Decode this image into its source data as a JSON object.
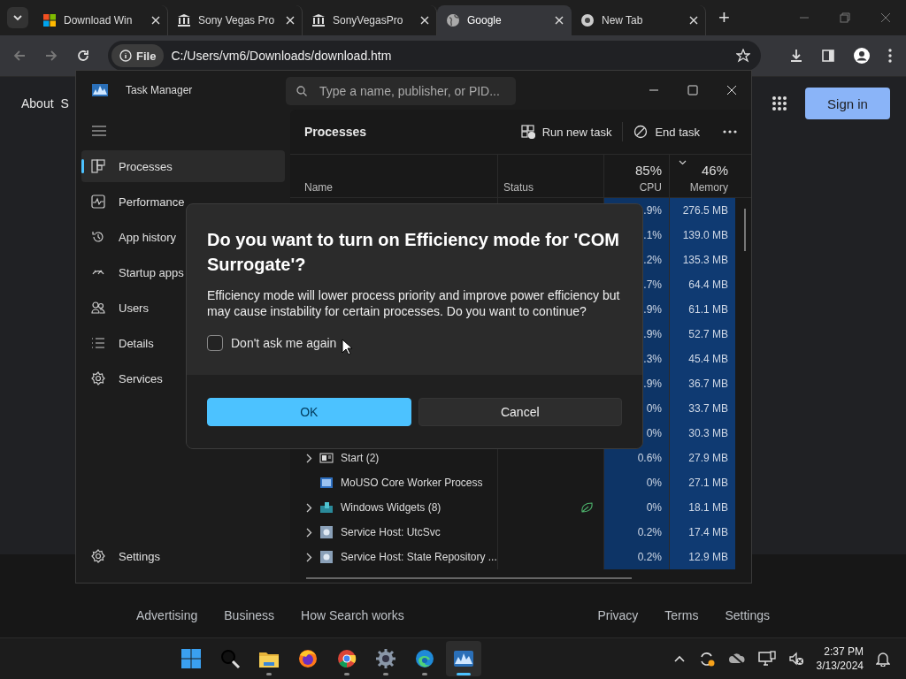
{
  "browser": {
    "tabs": [
      {
        "title": "Download Win",
        "selected": false
      },
      {
        "title": "Sony Vegas Pro",
        "selected": false
      },
      {
        "title": "SonyVegasPro",
        "selected": false
      },
      {
        "title": "Google",
        "selected": true
      },
      {
        "title": "New Tab",
        "selected": false
      }
    ],
    "new_tab": "+",
    "address": {
      "scheme": "File",
      "url": "C:/Users/vm6/Downloads/download.htm"
    }
  },
  "page": {
    "header_links": [
      "About",
      "S"
    ],
    "sign_in": "Sign in",
    "footer_left": [
      "Advertising",
      "Business",
      "How Search works"
    ],
    "footer_right": [
      "Privacy",
      "Terms",
      "Settings"
    ]
  },
  "task_manager": {
    "title": "Task Manager",
    "search": {
      "placeholder": "Type a name, publisher, or PID..."
    },
    "nav": [
      {
        "label": "Processes",
        "selected": true
      },
      {
        "label": "Performance",
        "selected": false
      },
      {
        "label": "App history",
        "selected": false
      },
      {
        "label": "Startup apps",
        "selected": false
      },
      {
        "label": "Users",
        "selected": false
      },
      {
        "label": "Details",
        "selected": false
      },
      {
        "label": "Services",
        "selected": false
      }
    ],
    "settings": "Settings",
    "heading": "Processes",
    "actions": [
      "Run new task",
      "End task"
    ],
    "columns": {
      "name": "Name",
      "status": "Status",
      "cpu_total": "85%",
      "cpu": "CPU",
      "memory_total": "46%",
      "memory": "Memory"
    },
    "rows": [
      {
        "cpu": ".9%",
        "memory": "276.5 MB"
      },
      {
        "cpu": ".1%",
        "memory": "139.0 MB"
      },
      {
        "cpu": ".2%",
        "memory": "135.3 MB"
      },
      {
        "cpu": ".7%",
        "memory": "64.4 MB"
      },
      {
        "cpu": ".9%",
        "memory": "61.1 MB"
      },
      {
        "cpu": ".9%",
        "memory": "52.7 MB"
      },
      {
        "cpu": ".3%",
        "memory": "45.4 MB"
      },
      {
        "cpu": ".9%",
        "memory": "36.7 MB"
      },
      {
        "cpu": "0%",
        "memory": "33.7 MB"
      },
      {
        "cpu": "0%",
        "memory": "30.3 MB"
      },
      {
        "name": "Start (2)",
        "kind": "start",
        "expandable": true,
        "efficiency": false,
        "cpu": "0.6%",
        "memory": "27.9 MB"
      },
      {
        "name": "MoUSO Core Worker Process",
        "kind": "app",
        "expandable": false,
        "efficiency": false,
        "cpu": "0%",
        "memory": "27.1 MB"
      },
      {
        "name": "Windows Widgets (8)",
        "kind": "widgets",
        "expandable": true,
        "efficiency": true,
        "cpu": "0%",
        "memory": "18.1 MB"
      },
      {
        "name": "Service Host: UtcSvc",
        "kind": "service",
        "expandable": true,
        "efficiency": false,
        "cpu": "0.2%",
        "memory": "17.4 MB"
      },
      {
        "name": "Service Host: State Repository ...",
        "kind": "service",
        "expandable": true,
        "efficiency": false,
        "cpu": "0.2%",
        "memory": "12.9 MB"
      }
    ]
  },
  "dialog": {
    "title": "Do you want to turn on Efficiency mode for 'COM Surrogate'?",
    "message": "Efficiency mode will lower process priority and improve power efficiency but may cause instability for certain processes. Do you want to continue?",
    "checkbox": {
      "label": "Don't ask me again",
      "checked": false
    },
    "buttons": [
      {
        "label": "OK",
        "primary": true
      },
      {
        "label": "Cancel",
        "primary": false
      }
    ]
  },
  "taskbar": {
    "apps": [
      {
        "running": false,
        "selected": false
      },
      {
        "running": false,
        "selected": false
      },
      {
        "running": true,
        "selected": false
      },
      {
        "running": false,
        "selected": false
      },
      {
        "running": true,
        "selected": false
      },
      {
        "running": true,
        "selected": false
      },
      {
        "running": true,
        "selected": false
      },
      {
        "running": true,
        "selected": true
      }
    ],
    "clock": {
      "time": "2:37 PM",
      "date": "3/13/2024"
    }
  }
}
